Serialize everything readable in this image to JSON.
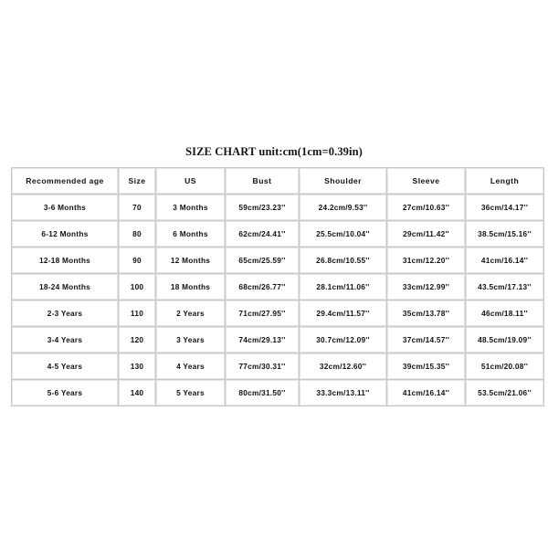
{
  "title": "SIZE CHART unit:cm(1cm=0.39in)",
  "table": {
    "headers": [
      "Recommended age",
      "Size",
      "US",
      "Bust",
      "Shoulder",
      "Sleeve",
      "Length"
    ],
    "rows": [
      {
        "age": "3-6 Months",
        "size": "70",
        "us": "3 Months",
        "bust": "59cm/23.23''",
        "shoulder": "24.2cm/9.53''",
        "sleeve": "27cm/10.63''",
        "length": "36cm/14.17''"
      },
      {
        "age": "6-12 Months",
        "size": "80",
        "us": "6 Months",
        "bust": "62cm/24.41''",
        "shoulder": "25.5cm/10.04''",
        "sleeve": "29cm/11.42''",
        "length": "38.5cm/15.16''"
      },
      {
        "age": "12-18 Months",
        "size": "90",
        "us": "12 Months",
        "bust": "65cm/25.59''",
        "shoulder": "26.8cm/10.55''",
        "sleeve": "31cm/12.20''",
        "length": "41cm/16.14''"
      },
      {
        "age": "18-24 Months",
        "size": "100",
        "us": "18 Months",
        "bust": "68cm/26.77''",
        "shoulder": "28.1cm/11.06''",
        "sleeve": "33cm/12.99''",
        "length": "43.5cm/17.13''"
      },
      {
        "age": "2-3 Years",
        "size": "110",
        "us": "2 Years",
        "bust": "71cm/27.95''",
        "shoulder": "29.4cm/11.57''",
        "sleeve": "35cm/13.78''",
        "length": "46cm/18.11''"
      },
      {
        "age": "3-4 Years",
        "size": "120",
        "us": "3 Years",
        "bust": "74cm/29.13''",
        "shoulder": "30.7cm/12.09''",
        "sleeve": "37cm/14.57''",
        "length": "48.5cm/19.09''"
      },
      {
        "age": "4-5 Years",
        "size": "130",
        "us": "4 Years",
        "bust": "77cm/30.31''",
        "shoulder": "32cm/12.60''",
        "sleeve": "39cm/15.35''",
        "length": "51cm/20.08''"
      },
      {
        "age": "5-6 Years",
        "size": "140",
        "us": "5 Years",
        "bust": "80cm/31.50''",
        "shoulder": "33.3cm/13.11''",
        "sleeve": "41cm/16.14''",
        "length": "53.5cm/21.06''"
      }
    ]
  },
  "chart_data": {
    "type": "table",
    "title": "SIZE CHART unit:cm(1cm=0.39in)",
    "columns": [
      "Recommended age",
      "Size",
      "US",
      "Bust",
      "Shoulder",
      "Sleeve",
      "Length"
    ],
    "rows": [
      [
        "3-6 Months",
        "70",
        "3 Months",
        "59cm/23.23''",
        "24.2cm/9.53''",
        "27cm/10.63''",
        "36cm/14.17''"
      ],
      [
        "6-12 Months",
        "80",
        "6 Months",
        "62cm/24.41''",
        "25.5cm/10.04''",
        "29cm/11.42''",
        "38.5cm/15.16''"
      ],
      [
        "12-18 Months",
        "90",
        "12 Months",
        "65cm/25.59''",
        "26.8cm/10.55''",
        "31cm/12.20''",
        "41cm/16.14''"
      ],
      [
        "18-24 Months",
        "100",
        "18 Months",
        "68cm/26.77''",
        "28.1cm/11.06''",
        "33cm/12.99''",
        "43.5cm/17.13''"
      ],
      [
        "2-3 Years",
        "110",
        "2 Years",
        "71cm/27.95''",
        "29.4cm/11.57''",
        "35cm/13.78''",
        "46cm/18.11''"
      ],
      [
        "3-4 Years",
        "120",
        "3 Years",
        "74cm/29.13''",
        "30.7cm/12.09''",
        "37cm/14.57''",
        "48.5cm/19.09''"
      ],
      [
        "4-5 Years",
        "130",
        "4 Years",
        "77cm/30.31''",
        "32cm/12.60''",
        "39cm/15.35''",
        "51cm/20.08''"
      ],
      [
        "5-6 Years",
        "140",
        "5 Years",
        "80cm/31.50''",
        "33.3cm/13.11''",
        "41cm/16.14''",
        "53.5cm/21.06''"
      ]
    ],
    "units_note": "unit:cm(1cm=0.39in)",
    "bust_cm": [
      59,
      62,
      65,
      68,
      71,
      74,
      77,
      80
    ],
    "bust_in": [
      23.23,
      24.41,
      25.59,
      26.77,
      27.95,
      29.13,
      30.31,
      31.5
    ],
    "shoulder_cm": [
      24.2,
      25.5,
      26.8,
      28.1,
      29.4,
      30.7,
      32,
      33.3
    ],
    "shoulder_in": [
      9.53,
      10.04,
      10.55,
      11.06,
      11.57,
      12.09,
      12.6,
      13.11
    ],
    "sleeve_cm": [
      27,
      29,
      31,
      33,
      35,
      37,
      39,
      41
    ],
    "sleeve_in": [
      10.63,
      11.42,
      12.2,
      12.99,
      13.78,
      14.57,
      15.35,
      16.14
    ],
    "length_cm": [
      36,
      38.5,
      41,
      43.5,
      46,
      48.5,
      51,
      53.5
    ],
    "length_in": [
      14.17,
      15.16,
      16.14,
      17.13,
      18.11,
      19.09,
      20.08,
      21.06
    ],
    "size_codes": [
      70,
      80,
      90,
      100,
      110,
      120,
      130,
      140
    ]
  },
  "colors": {
    "background": "#ffffff",
    "text": "#111111",
    "cell_border": "#e6e6e6",
    "grid_line": "#c9c9c9"
  }
}
